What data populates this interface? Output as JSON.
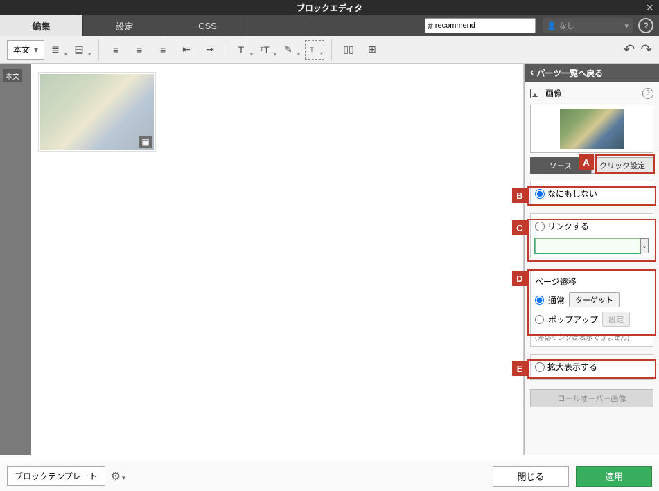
{
  "title": "ブロックエディタ",
  "main_tabs": [
    "編集",
    "設定",
    "CSS"
  ],
  "tag_field": {
    "hash": "#",
    "value": "recommend"
  },
  "user_select": {
    "label": "なし"
  },
  "toolbar": {
    "style_select": "本文"
  },
  "gutter_tag": "本文",
  "sidebar": {
    "back": "パーツ一覧へ戻る",
    "panel_title": "画像",
    "subtabs": {
      "source": "ソース",
      "click": "クリック設定"
    },
    "opt_none": "なにもしない",
    "opt_link": "リンクする",
    "page_transition": {
      "title": "ページ遷移",
      "normal": "通常",
      "target_btn": "ターゲット",
      "popup": "ポップアップ",
      "settings_btn": "設定",
      "note": "(外部リンクは表示できません)"
    },
    "opt_zoom": "拡大表示する",
    "rollover": "ロールオーバー画像"
  },
  "footer": {
    "template": "ブロックテンプレート",
    "close": "閉じる",
    "apply": "適用"
  },
  "markers": {
    "A": "A",
    "B": "B",
    "C": "C",
    "D": "D",
    "E": "E"
  }
}
